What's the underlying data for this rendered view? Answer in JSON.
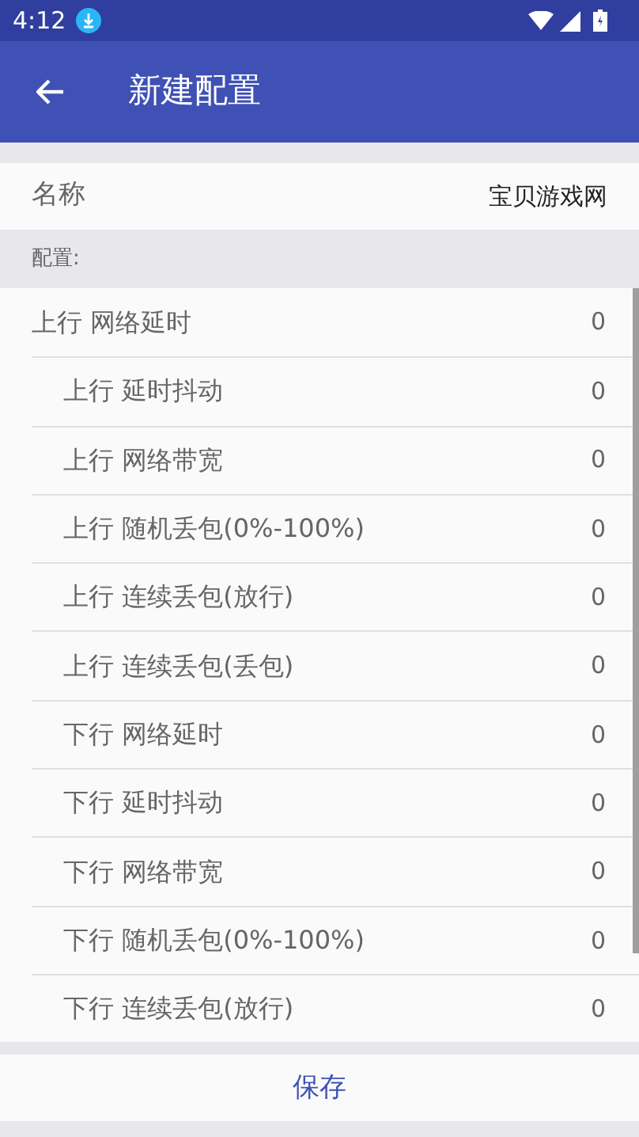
{
  "status_bar": {
    "time": "4:12"
  },
  "toolbar": {
    "title": "新建配置"
  },
  "name_field": {
    "label": "名称",
    "value": "宝贝游戏网"
  },
  "section": {
    "title": "配置:"
  },
  "settings": [
    {
      "label": "上行 网络延时",
      "value": "0"
    },
    {
      "label": "上行 延时抖动",
      "value": "0"
    },
    {
      "label": "上行 网络带宽",
      "value": "0"
    },
    {
      "label": "上行 随机丢包(0%-100%)",
      "value": "0"
    },
    {
      "label": "上行 连续丢包(放行)",
      "value": "0"
    },
    {
      "label": "上行 连续丢包(丢包)",
      "value": "0"
    },
    {
      "label": "下行 网络延时",
      "value": "0"
    },
    {
      "label": "下行 延时抖动",
      "value": "0"
    },
    {
      "label": "下行 网络带宽",
      "value": "0"
    },
    {
      "label": "下行 随机丢包(0%-100%)",
      "value": "0"
    },
    {
      "label": "下行 连续丢包(放行)",
      "value": "0"
    }
  ],
  "save_button": {
    "label": "保存"
  }
}
